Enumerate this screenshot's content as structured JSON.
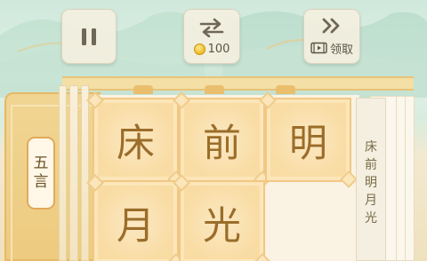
{
  "toolbar": {
    "swap_cost": "100",
    "claim_label": "领取"
  },
  "poem_type": [
    "五",
    "言"
  ],
  "tiles": [
    "床",
    "前",
    "明",
    "月",
    "光"
  ],
  "answer_column": [
    "床",
    "前",
    "明",
    "月",
    "光"
  ],
  "colors": {
    "tile_fill": "#f9dca3",
    "tile_text": "#9b6d2a",
    "frame_gold": "#e7b866",
    "sky_green": "#cfe8dc"
  },
  "icons": [
    "pause-icon",
    "swap-arrows-icon",
    "coin-icon",
    "fast-forward-icon",
    "video-ad-icon"
  ]
}
